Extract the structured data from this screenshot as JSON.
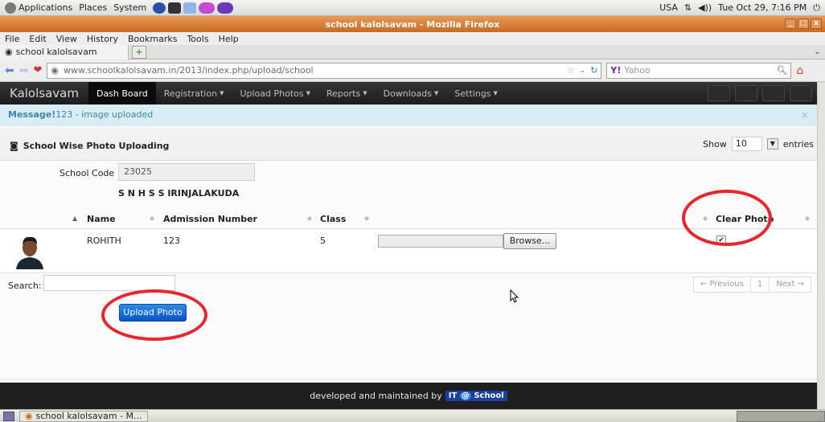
{
  "system_panel": {
    "menus": [
      "Applications",
      "Places",
      "System"
    ],
    "locale": "USA",
    "datetime": "Tue Oct 29,  7:16 PM"
  },
  "window": {
    "title": "school kalolsavam - Mozilla Firefox"
  },
  "firefox_menu": [
    "File",
    "Edit",
    "View",
    "History",
    "Bookmarks",
    "Tools",
    "Help"
  ],
  "tab": {
    "label": "school kalolsavam"
  },
  "url": "www.schoolkalolsavam.in/2013/index.php/upload/school",
  "search_engine_placeholder": "Yahoo",
  "app": {
    "brand": "Kalolsavam",
    "nav": [
      {
        "label": "Dash Board",
        "active": true
      },
      {
        "label": "Registration",
        "dropdown": true
      },
      {
        "label": "Upload Photos",
        "dropdown": true
      },
      {
        "label": "Reports",
        "dropdown": true
      },
      {
        "label": "Downloads",
        "dropdown": true
      },
      {
        "label": "Settings",
        "dropdown": true
      }
    ],
    "message_label": "Message!",
    "message_text": "123 - image uploaded",
    "message_close": "×",
    "panel_title": "School Wise Photo Uploading",
    "show_label": "Show",
    "entries_value": "10",
    "entries_label": "entries",
    "school_code_label": "School Code",
    "school_code_value": "23025",
    "school_name": "S N H S S IRINJALAKUDA",
    "columns": [
      "Name",
      "Admission Number",
      "Class",
      "Clear Photo"
    ],
    "rows": [
      {
        "name": "ROHITH",
        "admission_number": "123",
        "class": "5",
        "clear_photo": true
      }
    ],
    "browse_label": "Browse...",
    "search_label": "Search:",
    "pager": {
      "previous": "← Previous",
      "page": "1",
      "next": "Next →"
    },
    "upload_button": "Upload Photo",
    "footer_text": "developed and maintained by",
    "footer_logo": {
      "left": "IT",
      "at": "@",
      "right": "School"
    }
  },
  "taskbar_item": "school kalolsavam - M...",
  "colors": {
    "navbar_bg": "#1d1d1d",
    "alert_bg": "#d9edf7",
    "alert_text": "#3a87ad",
    "upload_button": "#0a54c8",
    "annotation_ring": "#e8262b"
  }
}
